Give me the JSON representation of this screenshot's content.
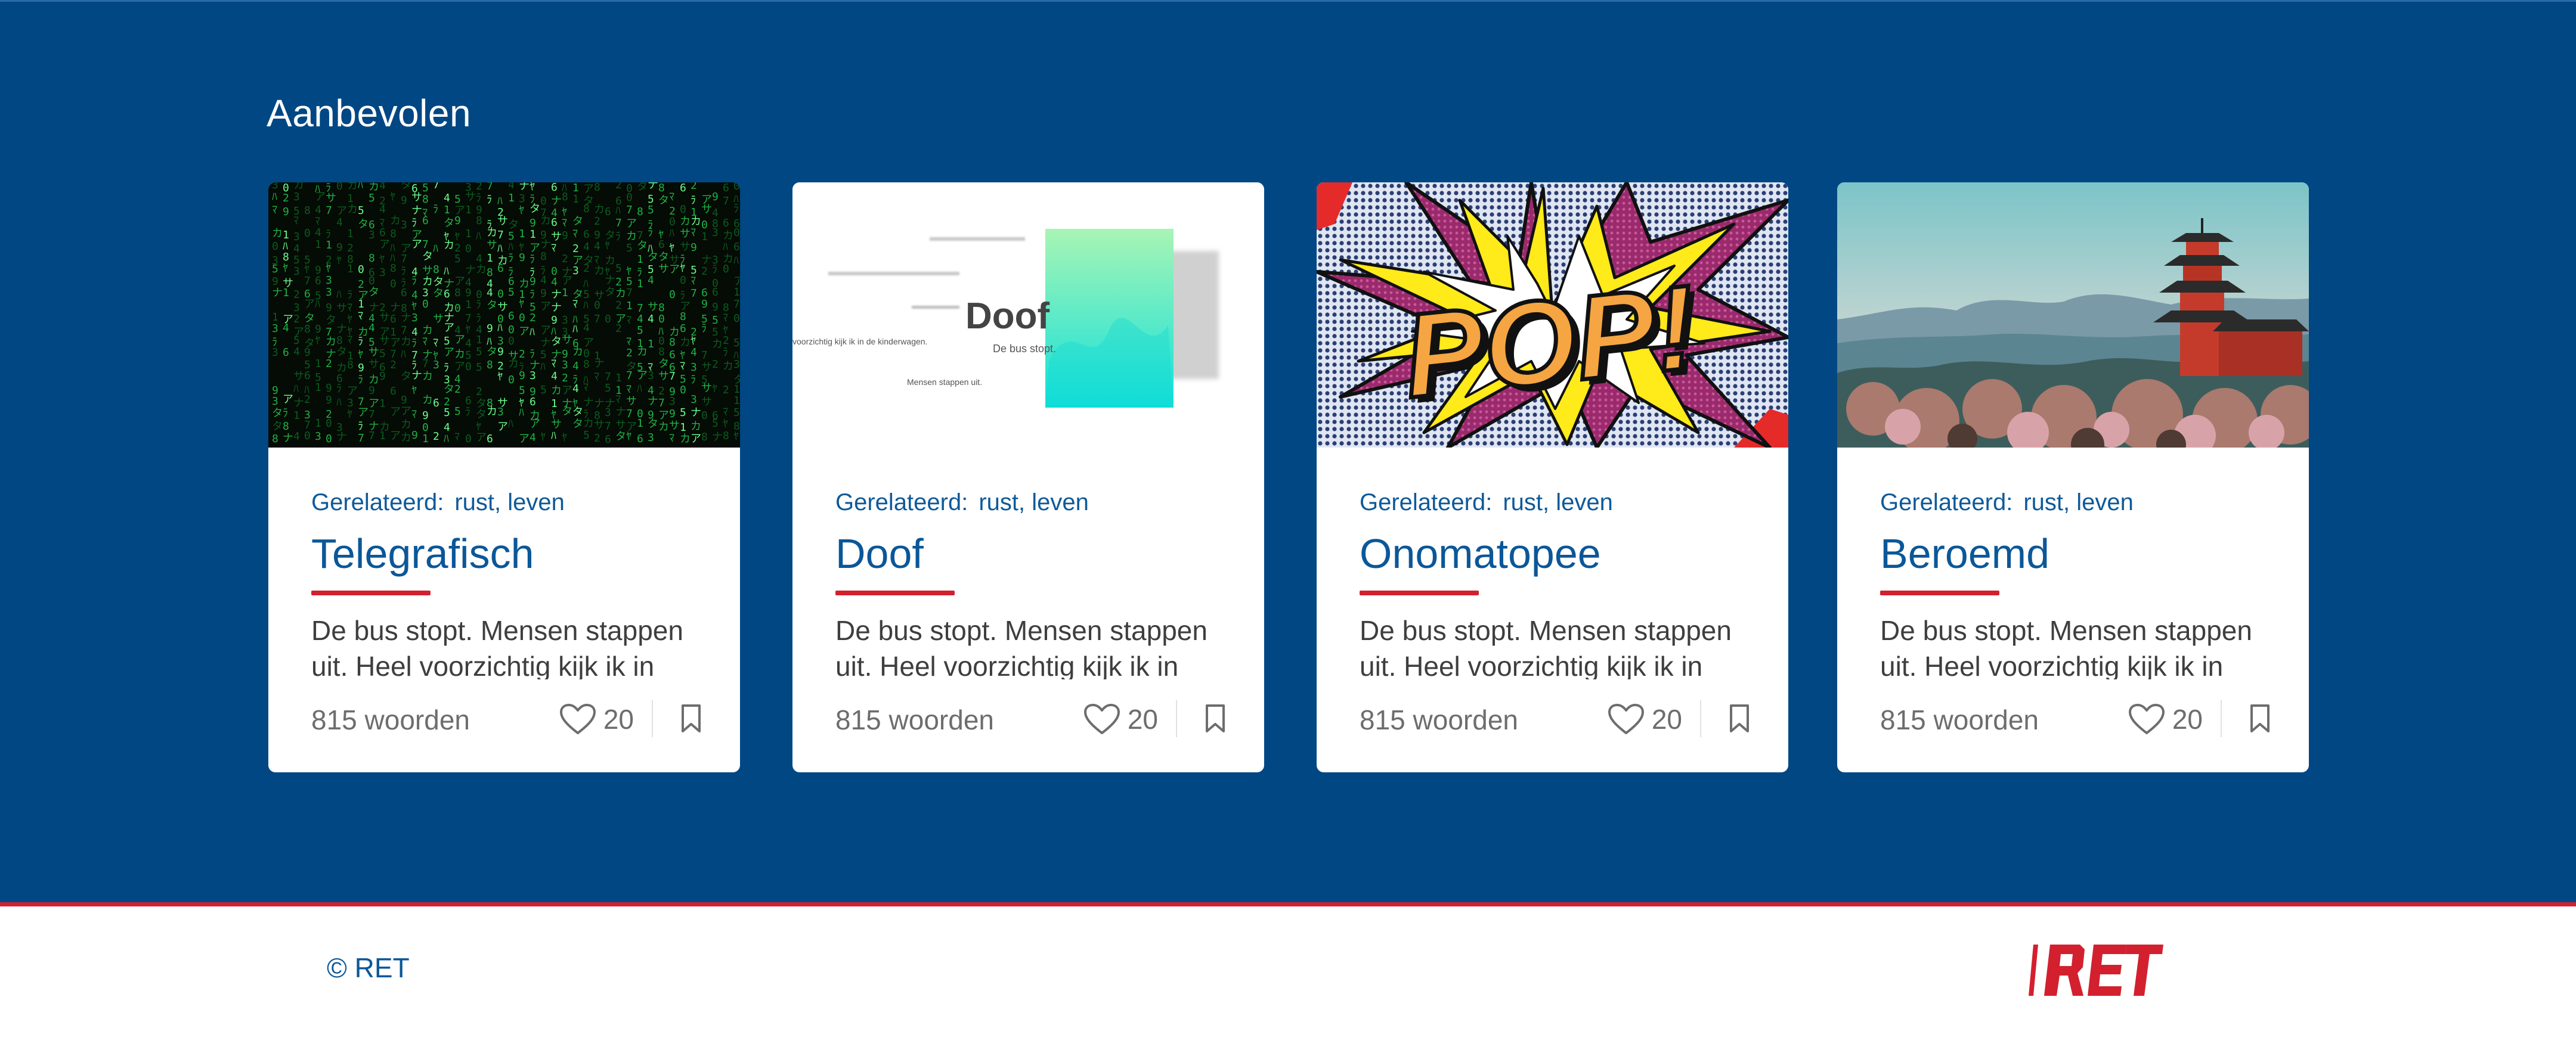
{
  "section": {
    "title": "Aanbevolen"
  },
  "cards": [
    {
      "image": "matrix-code-rain",
      "related_label": "Gerelateerd:",
      "related_tags": "rust, leven",
      "title": "Telegrafisch",
      "excerpt": "De bus stopt. Mensen stappen uit. Heel voorzichtig kijk ik in",
      "words": "815 woorden",
      "likes": "20",
      "like_icon": "heart-outline",
      "bookmark_icon": "bookmark-outline"
    },
    {
      "image": "doof-poster",
      "image_text": {
        "heading": "Doof",
        "line1": "De bus stopt.",
        "line2": "Mensen stappen uit.",
        "line3": "voorzichtig kijk ik in de kinderwagen."
      },
      "related_label": "Gerelateerd:",
      "related_tags": "rust, leven",
      "title": "Doof",
      "excerpt": "De bus stopt. Mensen stappen uit. Heel voorzichtig kijk ik in",
      "words": "815 woorden",
      "likes": "20",
      "like_icon": "heart-outline",
      "bookmark_icon": "bookmark-outline"
    },
    {
      "image": "pop-art-burst",
      "image_text": {
        "pop": "POP!"
      },
      "related_label": "Gerelateerd:",
      "related_tags": "rust, leven",
      "title": "Onomatopee",
      "excerpt": "De bus stopt. Mensen stappen uit. Heel voorzichtig kijk ik in",
      "words": "815 woorden",
      "likes": "20",
      "like_icon": "heart-outline",
      "bookmark_icon": "bookmark-outline"
    },
    {
      "image": "pagoda-landscape",
      "related_label": "Gerelateerd:",
      "related_tags": "rust, leven",
      "title": "Beroemd",
      "excerpt": "De bus stopt. Mensen stappen uit. Heel voorzichtig kijk ik in",
      "words": "815 woorden",
      "likes": "20",
      "like_icon": "heart-outline",
      "bookmark_icon": "bookmark-outline"
    }
  ],
  "footer": {
    "copyright": "© RET",
    "logo": "RET"
  },
  "colors": {
    "brand_blue": "#004784",
    "accent_red": "#d3202f",
    "title_blue": "#0b5798"
  }
}
